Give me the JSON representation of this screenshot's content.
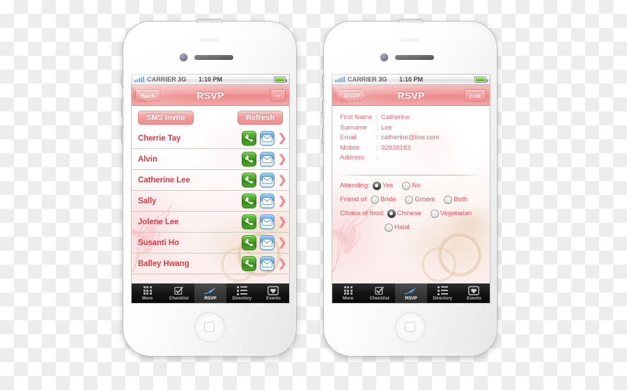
{
  "status_bar": {
    "carrier": "CARRIER 3G",
    "time": "1:10 PM",
    "signal_icon": "signal-bars-icon",
    "battery_icon": "battery-icon"
  },
  "tab_bar": {
    "tabs": [
      {
        "label": "More",
        "icon": "grid-dots-icon",
        "active": false
      },
      {
        "label": "Checklist",
        "icon": "checkbox-icon",
        "active": false
      },
      {
        "label": "RSVP",
        "icon": "pen-icon",
        "active": true
      },
      {
        "label": "Directory",
        "icon": "list-icon",
        "active": false
      },
      {
        "label": "Events",
        "icon": "heart-badge-icon",
        "active": false
      }
    ]
  },
  "list_screen": {
    "nav": {
      "back_label": "Back",
      "title": "RSVP",
      "add_label": "+"
    },
    "actions": {
      "sms_invite": "SMS Invite",
      "refresh": "Refresh"
    },
    "row_icons": {
      "call": "phone-icon",
      "email": "envelope-icon",
      "disclosure": "chevron-right-icon"
    },
    "contacts": [
      {
        "name": "Cherrie Tay"
      },
      {
        "name": "Alvin"
      },
      {
        "name": "Catherine Lee"
      },
      {
        "name": "Sally"
      },
      {
        "name": "Jolene Lee"
      },
      {
        "name": "Susanti Ho"
      },
      {
        "name": "Balley Hwang"
      }
    ]
  },
  "detail_screen": {
    "nav": {
      "back_label": "RSVP",
      "title": "RSVP",
      "edit_label": "Edit"
    },
    "fields": [
      {
        "label": "First Name",
        "separator": ":",
        "value": "Catherine"
      },
      {
        "label": "Surname",
        "separator": ":",
        "value": "Lee"
      },
      {
        "label": "Email",
        "separator": ":",
        "value": "catherine@live.com"
      },
      {
        "label": "Mobile",
        "separator": ":",
        "value": "92838183"
      },
      {
        "label": "Address",
        "separator": ":",
        "value": ""
      }
    ],
    "radio_groups": [
      {
        "label": "Attending:",
        "options": [
          {
            "text": "Yes",
            "selected": true
          },
          {
            "text": "No",
            "selected": false
          }
        ]
      },
      {
        "label": "Friend of:",
        "options": [
          {
            "text": "Bride",
            "selected": false
          },
          {
            "text": "Groom",
            "selected": false
          },
          {
            "text": "Both",
            "selected": false
          }
        ]
      },
      {
        "label": "Choice of food:",
        "options": [
          {
            "text": "Chinese",
            "selected": true
          },
          {
            "text": "Vegetarian",
            "selected": false
          }
        ]
      },
      {
        "label": "",
        "indent": true,
        "options": [
          {
            "text": "Halal",
            "selected": false
          }
        ]
      }
    ]
  },
  "colors": {
    "accent_pink": "#ef8e8e",
    "name_red": "#d9414c",
    "field_text": "#e06a72",
    "phone_green": "#3f9b1f",
    "mail_blue": "#5aa6e4",
    "tabbar_black": "#141414"
  }
}
